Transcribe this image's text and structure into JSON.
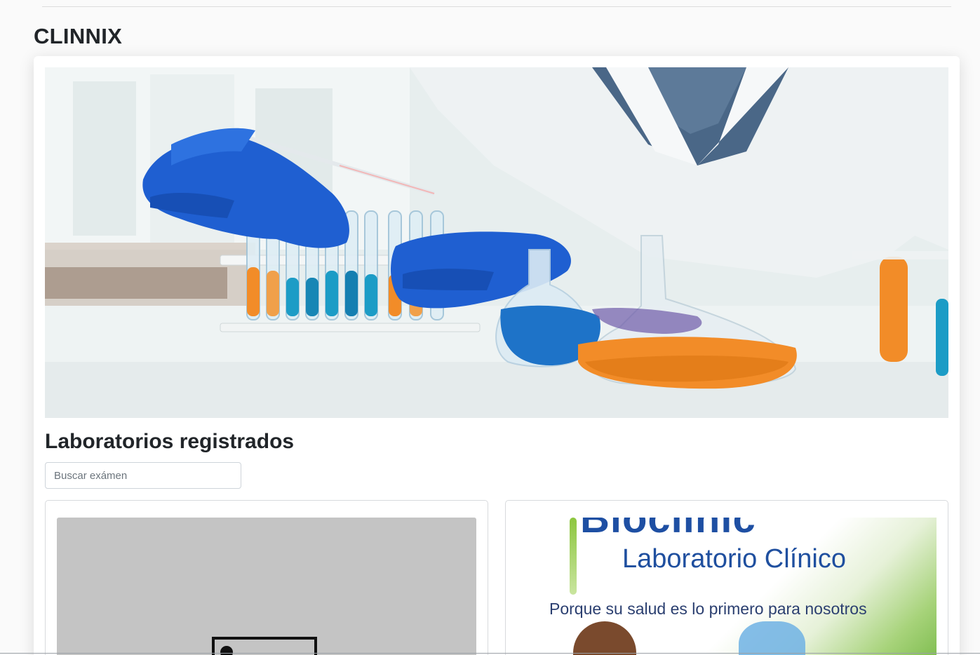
{
  "header": {
    "brand": "CLINNIX"
  },
  "main": {
    "section_title": "Laboratorios registrados",
    "search": {
      "placeholder": "Buscar exámen",
      "value": ""
    },
    "labs": [
      {
        "image": "broken-image-icon"
      },
      {
        "image_text": {
          "logo": "Bioclinic",
          "subtitle": "Laboratorio Clínico",
          "tagline": "Porque su salud es lo primero para nosotros"
        }
      }
    ]
  },
  "colors": {
    "background": "#fafafa",
    "card": "#ffffff",
    "text": "#212529",
    "glove_blue": "#1f5fd1",
    "liquid_orange": "#f28c28",
    "liquid_blue": "#1e73c8",
    "ad_blue": "#1e4fa3",
    "ad_green": "#8dc63f"
  }
}
